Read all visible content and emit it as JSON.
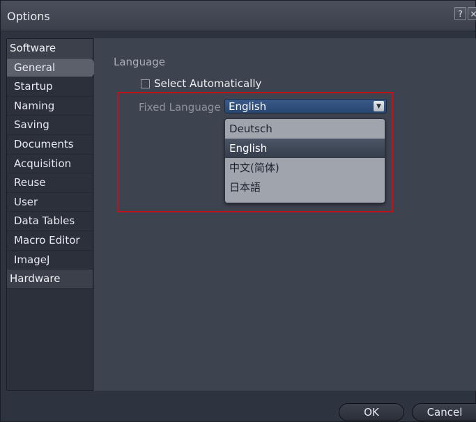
{
  "window": {
    "title": "Options",
    "help_label": "?",
    "close_label": "×"
  },
  "sidebar": {
    "categories": [
      {
        "label": "Software"
      },
      {
        "label": "Hardware"
      }
    ],
    "items": [
      {
        "label": "General",
        "selected": true
      },
      {
        "label": "Startup"
      },
      {
        "label": "Naming"
      },
      {
        "label": "Saving"
      },
      {
        "label": "Documents"
      },
      {
        "label": "Acquisition"
      },
      {
        "label": "Reuse"
      },
      {
        "label": "User"
      },
      {
        "label": "Data Tables"
      },
      {
        "label": "Macro Editor"
      },
      {
        "label": "ImageJ"
      }
    ]
  },
  "main": {
    "section_label": "Language",
    "select_auto": {
      "label": "Select Automatically",
      "checked": false
    },
    "fixed_language": {
      "label": "Fixed Language",
      "value": "English",
      "options": [
        "Deutsch",
        "English",
        "中文(简体)",
        "日本語"
      ]
    }
  },
  "footer": {
    "ok_label": "OK",
    "cancel_label": "Cancel"
  },
  "colors": {
    "highlight_border": "#c0121b",
    "selected_option_bg": "#3f4857"
  }
}
